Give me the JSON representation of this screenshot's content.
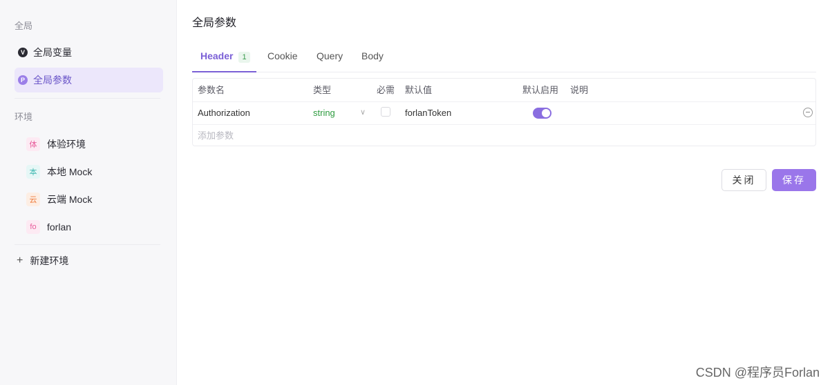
{
  "sidebar": {
    "global_label": "全局",
    "global_items": [
      {
        "label": "全局变量",
        "icon": "v-circle-icon",
        "icon_glyph": "V",
        "active": false
      },
      {
        "label": "全局参数",
        "icon": "p-circle-icon",
        "icon_glyph": "P",
        "active": true
      }
    ],
    "env_label": "环境",
    "environments": [
      {
        "badge": "体",
        "label": "体验环境",
        "badge_color": "#e85a9a",
        "badge_bg": "#fdeaf3"
      },
      {
        "badge": "本",
        "label": "本地 Mock",
        "badge_color": "#3fb8b0",
        "badge_bg": "#e6f7f6"
      },
      {
        "badge": "云",
        "label": "云端 Mock",
        "badge_color": "#ee7a3a",
        "badge_bg": "#fdeee4"
      },
      {
        "badge": "fo",
        "label": "forlan",
        "badge_color": "#e85a9a",
        "badge_bg": "#fdeaf3"
      }
    ],
    "new_env_label": "新建环境"
  },
  "main": {
    "title": "全局参数",
    "tabs": [
      {
        "label": "Header",
        "count": "1",
        "active": true
      },
      {
        "label": "Cookie",
        "active": false
      },
      {
        "label": "Query",
        "active": false
      },
      {
        "label": "Body",
        "active": false
      }
    ],
    "table": {
      "headers": [
        "参数名",
        "类型",
        "必需",
        "默认值",
        "默认启用",
        "说明"
      ],
      "rows": [
        {
          "name": "Authorization",
          "type": "string",
          "required": false,
          "default": "forlanToken",
          "enabled": true,
          "description": ""
        }
      ],
      "add_placeholder": "添加参数"
    },
    "buttons": {
      "close": "关闭",
      "save": "保存"
    }
  },
  "watermark": "CSDN @程序员Forlan",
  "colors": {
    "accent": "#7a5fd6",
    "save_button": "#9a76ea",
    "type_green": "#2e9b3f"
  }
}
